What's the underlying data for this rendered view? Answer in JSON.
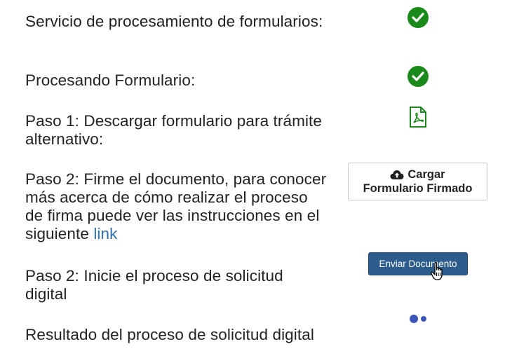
{
  "rows": [
    {
      "label": "Servicio de procesamiento de formularios:",
      "status": "check-circle-icon"
    },
    {
      "label": "Procesando Formulario:",
      "status": "check-circle-icon"
    },
    {
      "label": "Paso 1: Descargar formulario para trámite alternativo:",
      "action": "pdf-icon"
    },
    {
      "label_before_link": "Paso 2: Firme el documento, para conocer más acerca de cómo realizar el proceso de firma puede ver las instrucciones en el siguiente ",
      "link_text": "link"
    },
    {
      "label": "Paso 2: Inicie el proceso de solicitud digital"
    },
    {
      "label": "Resultado del proceso de solicitud digital"
    }
  ],
  "buttons": {
    "upload_line1": "Cargar",
    "upload_line2": "Formulario Firmado",
    "send": "Enviar Documento"
  },
  "colors": {
    "success": "#1a8a1a",
    "link": "#2f6fad",
    "primary_button": "#2c5c8c",
    "spinner": "#3b55b8"
  }
}
